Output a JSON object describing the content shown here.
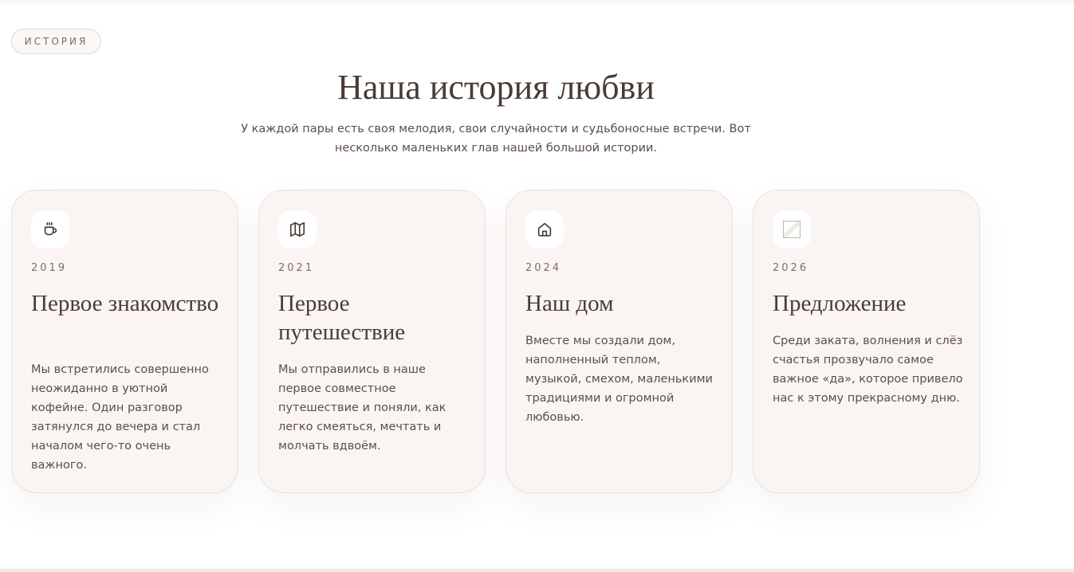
{
  "section": {
    "eyebrow": "ИСТОРИЯ",
    "title": "Наша история любви",
    "subtitle": "У каждой пары есть своя мелодия, свои случайности и судьбоносные встречи. Вот несколько маленьких глав нашей большой истории."
  },
  "cards": [
    {
      "icon": "coffee-cup-icon",
      "year": "2019",
      "title": "Первое знакомство",
      "text": "Мы встретились совершенно неожиданно в уютной кофейне. Один разговор затянулся до вечера и стал началом чего-то очень важного."
    },
    {
      "icon": "map-icon",
      "year": "2021",
      "title": "Первое путешествие",
      "text": "Мы отправились в наше первое совместное путешествие и поняли, как легко смеяться, мечтать и молчать вдвоём."
    },
    {
      "icon": "home-icon",
      "year": "2024",
      "title": "Наш дом",
      "text": "Вместе мы создали дом, наполненный теплом, музыкой, смехом, маленькими традициями и огромной любовью."
    },
    {
      "icon": "broken-image-icon",
      "year": "2026",
      "title": "Предложение",
      "text": "Среди заката, волнения и слёз счастья прозвучало самое важное «да», которое привело нас к этому прекрасному дню."
    }
  ],
  "colors": {
    "heading": "#4a3b35",
    "body_text": "#5d4e47",
    "card_background": "#faf5f2",
    "card_border": "#ece1da"
  }
}
